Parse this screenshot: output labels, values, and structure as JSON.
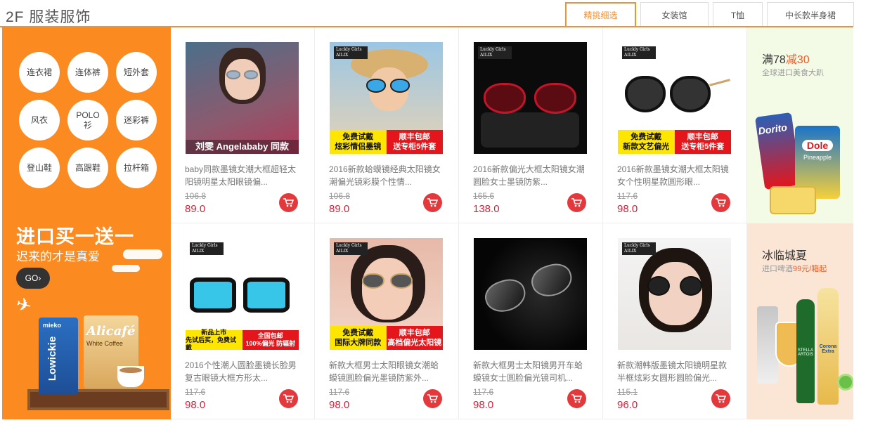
{
  "floor": {
    "title": "2F 服装服饰",
    "tabs": [
      {
        "label": "精挑细选",
        "active": true
      },
      {
        "label": "女装馆",
        "active": false
      },
      {
        "label": "T恤",
        "active": false
      },
      {
        "label": "中长款半身裙",
        "active": false
      }
    ]
  },
  "promo": {
    "categories": [
      "连衣裙",
      "连体裤",
      "短外套",
      "风衣",
      "POLO衫",
      "迷彩裤",
      "登山鞋",
      "高跟鞋",
      "拉杆箱"
    ],
    "title": "进口买一送一",
    "subtitle": "迟来的才是真爱",
    "go_label": "GO",
    "pack1_text": "Lowickie",
    "pack1_top": "mieko",
    "pack2_brand": "Alicafé",
    "pack2_sub": "White Coffee"
  },
  "products": [
    {
      "title": "baby同款墨镜女潮大框超轻太阳镜明星太阳眼镜偏...",
      "old_price": "106.8",
      "price": "89.0",
      "image_caption": "刘雯 Angelababy 同款",
      "banner": null
    },
    {
      "title": "2016新款蛤蟆镜经典太阳镜女潮偏光镜彩膜个性情...",
      "old_price": "106.8",
      "price": "89.0",
      "brand": "Luckly Girls AILIX",
      "banner": {
        "left1": "免费试戴",
        "left2": "炫彩情侣墨镜",
        "right1": "顺丰包邮",
        "right2": "送专柜5件套"
      }
    },
    {
      "title": "2016新款偏光大框太阳镜女潮圆脸女士墨镜防紫...",
      "old_price": "165.6",
      "price": "138.0",
      "brand": "Luckly Girls AILIX",
      "banner": null
    },
    {
      "title": "2016新款墨镜女潮大框太阳镜女个性明星款圆形眼...",
      "old_price": "117.6",
      "price": "98.0",
      "brand": "Luckly Girls AILIX",
      "banner": {
        "left1": "免费试戴",
        "left2": "新款文艺偏光",
        "right1": "顺丰包邮",
        "right2": "送专柜5件套"
      }
    },
    {
      "title": "2016个性潮人圆脸墨镜长脸男复古眼镜大框方形太...",
      "old_price": "117.6",
      "price": "98.0",
      "brand": "Luckly Girls AILIX",
      "banner": {
        "left1": "新品上市",
        "left2": "先试后买，免费试戴",
        "right1": "全国包邮",
        "right2": "100%偏光 防辐射"
      }
    },
    {
      "title": "新款大框男士太阳眼镜女潮蛤蟆镜圆脸偏光墨镜防紫外...",
      "old_price": "117.6",
      "price": "98.0",
      "brand": "Luckly Girls AILIX",
      "banner": {
        "left1": "免费试戴",
        "left2": "国际大牌同款",
        "right1": "顺丰包邮",
        "right2": "高档偏光太阳镜"
      }
    },
    {
      "title": "新款大框男士太阳镜男开车蛤蟆镜女士圆脸偏光镜司机...",
      "old_price": "117.6",
      "price": "98.0",
      "banner": null
    },
    {
      "title": "新款潮韩版墨镜太阳镜明星款半框炫彩女圆形圆脸偏光...",
      "old_price": "115.1",
      "price": "96.0",
      "brand": "Luckly Girls AILIX",
      "banner": null
    }
  ],
  "ads": [
    {
      "title_pre": "满78",
      "title_hl": "减30",
      "sub_pre": "全球进口美食大趴",
      "sub_hl": "",
      "pack_a": "Dorito",
      "pack_b": "Dole",
      "pack_b_sub": "Pineapple"
    },
    {
      "title_pre": "冰临城夏",
      "title_hl": "",
      "sub_pre": "进口啤酒",
      "sub_hl": "99元/箱起",
      "bottle_a": "STELLA ARTOIS",
      "bottle_b": "Corona Extra"
    }
  ],
  "colors": {
    "accent": "#f19130",
    "promo_bg": "#fb8a20",
    "price": "#d1233a",
    "cart": "#e4393c"
  }
}
